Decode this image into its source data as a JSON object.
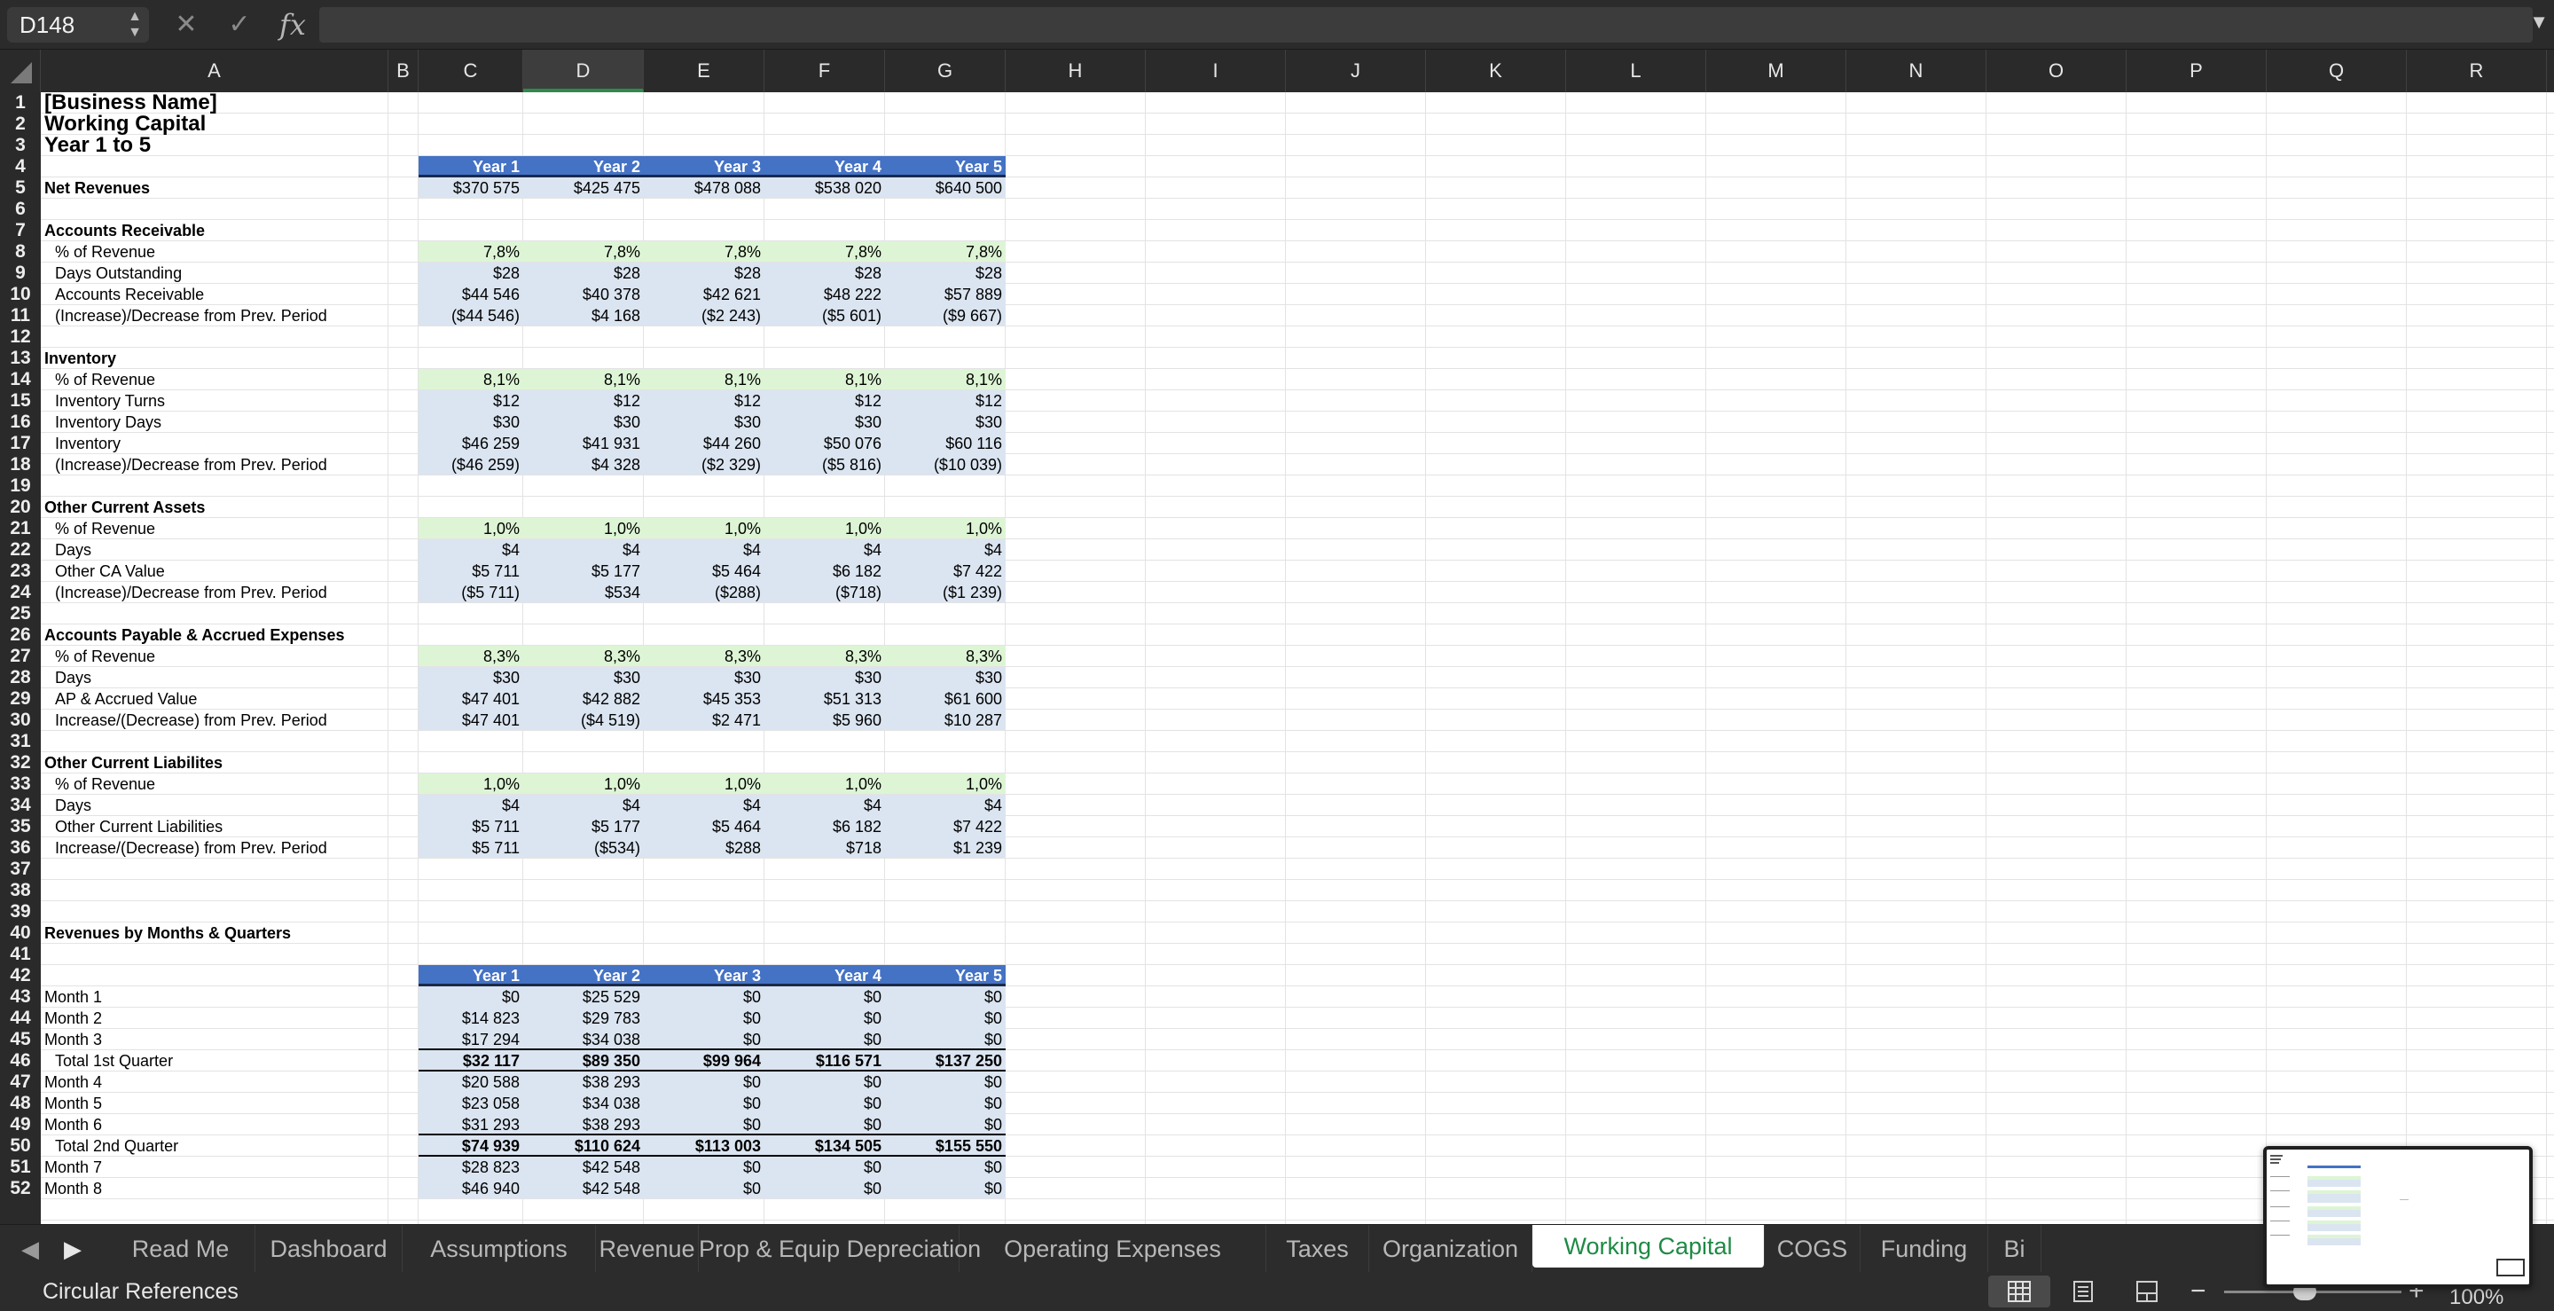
{
  "formula_bar": {
    "name_box": "D148",
    "cancel_icon": "close-icon",
    "confirm_icon": "check-icon",
    "fx_label": "fx",
    "formula": ""
  },
  "columns": [
    "A",
    "B",
    "C",
    "D",
    "E",
    "F",
    "G",
    "H",
    "I",
    "J",
    "K",
    "L",
    "M",
    "N",
    "O",
    "P",
    "Q",
    "R"
  ],
  "selected_column": "D",
  "rows": [
    "1",
    "2",
    "3",
    "4",
    "5",
    "6",
    "7",
    "8",
    "9",
    "10",
    "11",
    "12",
    "13",
    "14",
    "15",
    "16",
    "17",
    "18",
    "19",
    "20",
    "21",
    "22",
    "23",
    "24",
    "25",
    "26",
    "27",
    "28",
    "29",
    "30",
    "31",
    "32",
    "33",
    "34",
    "35",
    "36",
    "37",
    "38",
    "39",
    "40",
    "41",
    "42",
    "43",
    "44",
    "45",
    "46",
    "47",
    "48",
    "49",
    "50",
    "51",
    "52"
  ],
  "sheet": {
    "title_lines": [
      "[Business Name]",
      "Working Capital",
      "Year 1 to 5"
    ],
    "year_headers": [
      "Year 1",
      "Year 2",
      "Year 3",
      "Year 4",
      "Year 5"
    ],
    "net_revenues": {
      "label": "Net Revenues",
      "values": [
        "$370 575",
        "$425 475",
        "$478 088",
        "$538 020",
        "$640 500"
      ]
    },
    "sections": [
      {
        "title": "Accounts Receivable",
        "rows": [
          {
            "label": "% of Revenue",
            "values": [
              "7,8%",
              "7,8%",
              "7,8%",
              "7,8%",
              "7,8%"
            ]
          },
          {
            "label": "Days Outstanding",
            "values": [
              "$28",
              "$28",
              "$28",
              "$28",
              "$28"
            ]
          },
          {
            "label": "Accounts Receivable",
            "values": [
              "$44 546",
              "$40 378",
              "$42 621",
              "$48 222",
              "$57 889"
            ]
          },
          {
            "label": "(Increase)/Decrease from Prev. Period",
            "values": [
              "($44 546)",
              "$4 168",
              "($2 243)",
              "($5 601)",
              "($9 667)"
            ]
          }
        ]
      },
      {
        "title": "Inventory",
        "rows": [
          {
            "label": "% of Revenue",
            "values": [
              "8,1%",
              "8,1%",
              "8,1%",
              "8,1%",
              "8,1%"
            ]
          },
          {
            "label": "Inventory Turns",
            "values": [
              "$12",
              "$12",
              "$12",
              "$12",
              "$12"
            ]
          },
          {
            "label": "Inventory Days",
            "values": [
              "$30",
              "$30",
              "$30",
              "$30",
              "$30"
            ]
          },
          {
            "label": "Inventory",
            "values": [
              "$46 259",
              "$41 931",
              "$44 260",
              "$50 076",
              "$60 116"
            ]
          },
          {
            "label": "(Increase)/Decrease from Prev. Period",
            "values": [
              "($46 259)",
              "$4 328",
              "($2 329)",
              "($5 816)",
              "($10 039)"
            ]
          }
        ]
      },
      {
        "title": "Other Current Assets",
        "rows": [
          {
            "label": "% of Revenue",
            "values": [
              "1,0%",
              "1,0%",
              "1,0%",
              "1,0%",
              "1,0%"
            ]
          },
          {
            "label": "Days",
            "values": [
              "$4",
              "$4",
              "$4",
              "$4",
              "$4"
            ]
          },
          {
            "label": "Other CA Value",
            "values": [
              "$5 711",
              "$5 177",
              "$5 464",
              "$6 182",
              "$7 422"
            ]
          },
          {
            "label": "(Increase)/Decrease from Prev. Period",
            "values": [
              "($5 711)",
              "$534",
              "($288)",
              "($718)",
              "($1 239)"
            ]
          }
        ]
      },
      {
        "title": "Accounts Payable & Accrued Expenses",
        "rows": [
          {
            "label": "% of Revenue",
            "values": [
              "8,3%",
              "8,3%",
              "8,3%",
              "8,3%",
              "8,3%"
            ]
          },
          {
            "label": "Days",
            "values": [
              "$30",
              "$30",
              "$30",
              "$30",
              "$30"
            ]
          },
          {
            "label": "AP & Accrued Value",
            "values": [
              "$47 401",
              "$42 882",
              "$45 353",
              "$51 313",
              "$61 600"
            ]
          },
          {
            "label": "Increase/(Decrease) from Prev. Period",
            "values": [
              "$47 401",
              "($4 519)",
              "$2 471",
              "$5 960",
              "$10 287"
            ]
          }
        ]
      },
      {
        "title": "Other Current Liabilites",
        "rows": [
          {
            "label": "% of Revenue",
            "values": [
              "1,0%",
              "1,0%",
              "1,0%",
              "1,0%",
              "1,0%"
            ]
          },
          {
            "label": "Days",
            "values": [
              "$4",
              "$4",
              "$4",
              "$4",
              "$4"
            ]
          },
          {
            "label": "Other Current Liabilities",
            "values": [
              "$5 711",
              "$5 177",
              "$5 464",
              "$6 182",
              "$7 422"
            ]
          },
          {
            "label": "Increase/(Decrease) from Prev. Period",
            "values": [
              "$5 711",
              "($534)",
              "$288",
              "$718",
              "$1 239"
            ]
          }
        ]
      }
    ],
    "revenues_title": "Revenues by Months & Quarters",
    "revenue_rows": [
      {
        "label": "Month 1",
        "values": [
          "$0",
          "$25 529",
          "$0",
          "$0",
          "$0"
        ]
      },
      {
        "label": "Month 2",
        "values": [
          "$14 823",
          "$29 783",
          "$0",
          "$0",
          "$0"
        ]
      },
      {
        "label": "Month 3",
        "values": [
          "$17 294",
          "$34 038",
          "$0",
          "$0",
          "$0"
        ]
      },
      {
        "label": "Total 1st Quarter",
        "total": true,
        "values": [
          "$32 117",
          "$89 350",
          "$99 964",
          "$116 571",
          "$137 250"
        ]
      },
      {
        "label": "Month 4",
        "values": [
          "$20 588",
          "$38 293",
          "$0",
          "$0",
          "$0"
        ]
      },
      {
        "label": "Month 5",
        "values": [
          "$23 058",
          "$34 038",
          "$0",
          "$0",
          "$0"
        ]
      },
      {
        "label": "Month 6",
        "values": [
          "$31 293",
          "$38 293",
          "$0",
          "$0",
          "$0"
        ]
      },
      {
        "label": "Total 2nd Quarter",
        "total": true,
        "values": [
          "$74 939",
          "$110 624",
          "$113 003",
          "$134 505",
          "$155 550"
        ]
      },
      {
        "label": "Month 7",
        "values": [
          "$28 823",
          "$42 548",
          "$0",
          "$0",
          "$0"
        ]
      },
      {
        "label": "Month 8",
        "values": [
          "$46 940",
          "$42 548",
          "$0",
          "$0",
          "$0"
        ]
      }
    ]
  },
  "tabs": [
    "Read Me",
    "Dashboard",
    "Assumptions",
    "Revenue",
    "Prop & Equip Depreciation",
    "Operating Expenses",
    "Taxes",
    "Organization",
    "Working Capital",
    "COGS",
    "Funding",
    "Bi"
  ],
  "active_tab": "Working Capital",
  "status": {
    "text": "Circular References",
    "zoom": "100%",
    "view_icons": [
      "grid-view-icon",
      "page-layout-icon",
      "page-break-icon"
    ]
  },
  "colors": {
    "header_band": "#4472c4",
    "input_fill": "#ddf5d5",
    "calc_fill": "#dbe5f1",
    "active_tab_text": "#1e8a45"
  }
}
